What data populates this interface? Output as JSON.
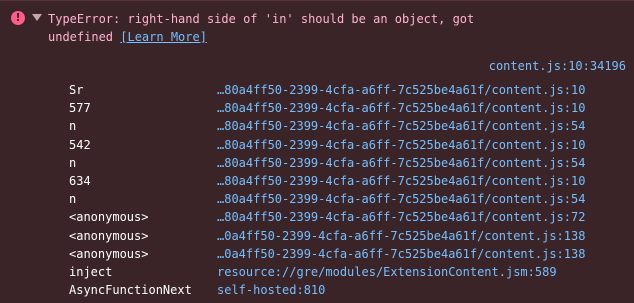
{
  "error": {
    "icon": "error-icon",
    "icon_glyph": "!",
    "message_text": "TypeError: right-hand side of 'in' should be an object, got\nundefined ",
    "learn_more": "[Learn More]",
    "location": "content.js:10:34196"
  },
  "stack": [
    {
      "fn": "Sr",
      "src": "…80a4ff50-2399-4cfa-a6ff-7c525be4a61f/content.js:10"
    },
    {
      "fn": "577",
      "src": "…80a4ff50-2399-4cfa-a6ff-7c525be4a61f/content.js:10"
    },
    {
      "fn": "n",
      "src": "…80a4ff50-2399-4cfa-a6ff-7c525be4a61f/content.js:54"
    },
    {
      "fn": "542",
      "src": "…80a4ff50-2399-4cfa-a6ff-7c525be4a61f/content.js:10"
    },
    {
      "fn": "n",
      "src": "…80a4ff50-2399-4cfa-a6ff-7c525be4a61f/content.js:54"
    },
    {
      "fn": "634",
      "src": "…80a4ff50-2399-4cfa-a6ff-7c525be4a61f/content.js:10"
    },
    {
      "fn": "n",
      "src": "…80a4ff50-2399-4cfa-a6ff-7c525be4a61f/content.js:54"
    },
    {
      "fn": "<anonymous>",
      "src": "…80a4ff50-2399-4cfa-a6ff-7c525be4a61f/content.js:72"
    },
    {
      "fn": "<anonymous>",
      "src": "…0a4ff50-2399-4cfa-a6ff-7c525be4a61f/content.js:138"
    },
    {
      "fn": "<anonymous>",
      "src": "…0a4ff50-2399-4cfa-a6ff-7c525be4a61f/content.js:138"
    },
    {
      "fn": "inject",
      "src": "resource://gre/modules/ExtensionContent.jsm:589"
    },
    {
      "fn": "AsyncFunctionNext",
      "src": "self-hosted:810"
    }
  ],
  "colors": {
    "background": "#3b2428",
    "error_text": "#ffb3d2",
    "link": "#75bfff",
    "function_name": "#ffffff",
    "error_icon": "#ff5c8a"
  }
}
